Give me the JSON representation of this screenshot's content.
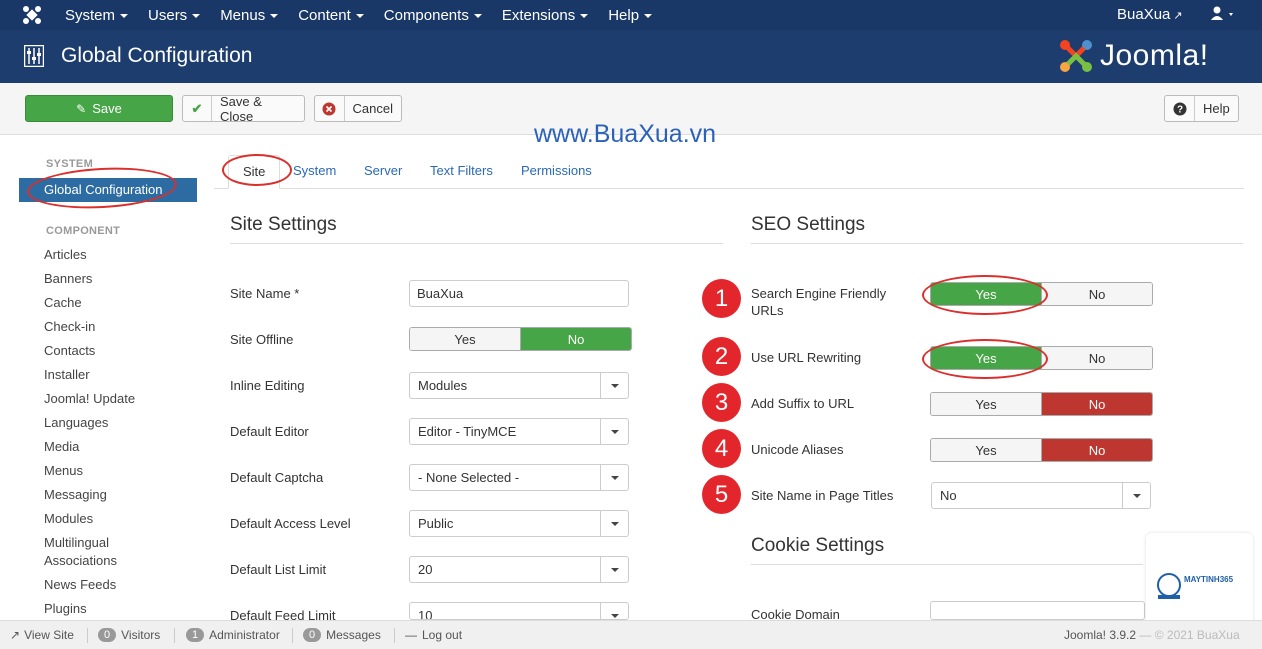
{
  "navbar": {
    "menu": [
      "System",
      "Users",
      "Menus",
      "Content",
      "Components",
      "Extensions",
      "Help"
    ],
    "user_link": "BuaXua"
  },
  "header": {
    "title": "Global Configuration",
    "brand": "Joomla!"
  },
  "toolbar": {
    "save": "Save",
    "save_close": "Save & Close",
    "cancel": "Cancel",
    "help": "Help"
  },
  "watermark": "www.BuaXua.vn",
  "sidebar": {
    "system_heading": "SYSTEM",
    "active_item": "Global Configuration",
    "component_heading": "COMPONENT",
    "items": [
      "Articles",
      "Banners",
      "Cache",
      "Check-in",
      "Contacts",
      "Installer",
      "Joomla! Update",
      "Languages",
      "Media",
      "Menus",
      "Messaging",
      "Modules",
      "Multilingual Associations",
      "News Feeds",
      "Plugins"
    ]
  },
  "tabs": [
    "Site",
    "System",
    "Server",
    "Text Filters",
    "Permissions"
  ],
  "site_settings": {
    "title": "Site Settings",
    "fields": {
      "site_name": {
        "label": "Site Name *",
        "value": "BuaXua"
      },
      "site_offline": {
        "label": "Site Offline",
        "yes": "Yes",
        "no": "No"
      },
      "inline_editing": {
        "label": "Inline Editing",
        "value": "Modules"
      },
      "default_editor": {
        "label": "Default Editor",
        "value": "Editor - TinyMCE"
      },
      "default_captcha": {
        "label": "Default Captcha",
        "value": "- None Selected -"
      },
      "default_access": {
        "label": "Default Access Level",
        "value": "Public"
      },
      "default_list_limit": {
        "label": "Default List Limit",
        "value": "20"
      },
      "default_feed_limit": {
        "label": "Default Feed Limit",
        "value": "10"
      }
    }
  },
  "seo_settings": {
    "title": "SEO Settings",
    "fields": {
      "sef": {
        "badge": "1",
        "label": "Search Engine Friendly URLs",
        "yes": "Yes",
        "no": "No"
      },
      "rewrite": {
        "badge": "2",
        "label": "Use URL Rewriting",
        "yes": "Yes",
        "no": "No"
      },
      "suffix": {
        "badge": "3",
        "label": "Add Suffix to URL",
        "yes": "Yes",
        "no": "No"
      },
      "unicode": {
        "badge": "4",
        "label": "Unicode Aliases",
        "yes": "Yes",
        "no": "No"
      },
      "sitename_titles": {
        "badge": "5",
        "label": "Site Name in Page Titles",
        "value": "No"
      }
    }
  },
  "cookie_settings": {
    "title": "Cookie Settings",
    "cookie_domain_label": "Cookie Domain"
  },
  "statusbar": {
    "view_site": "View Site",
    "visitors_count": "0",
    "visitors": "Visitors",
    "admin_count": "1",
    "administrator": "Administrator",
    "messages_count": "0",
    "messages": "Messages",
    "logout": "Log out",
    "version": "Joomla! 3.9.2",
    "copyright": "— © 2021 BuaXua"
  },
  "corner_logo_text": "MAYTINH365",
  "colors": {
    "navbar": "#1a3867",
    "header": "#1c3d6e",
    "green": "#46a546",
    "red": "#bd362f",
    "link": "#2a69b8",
    "highlight": "#d9302c"
  }
}
